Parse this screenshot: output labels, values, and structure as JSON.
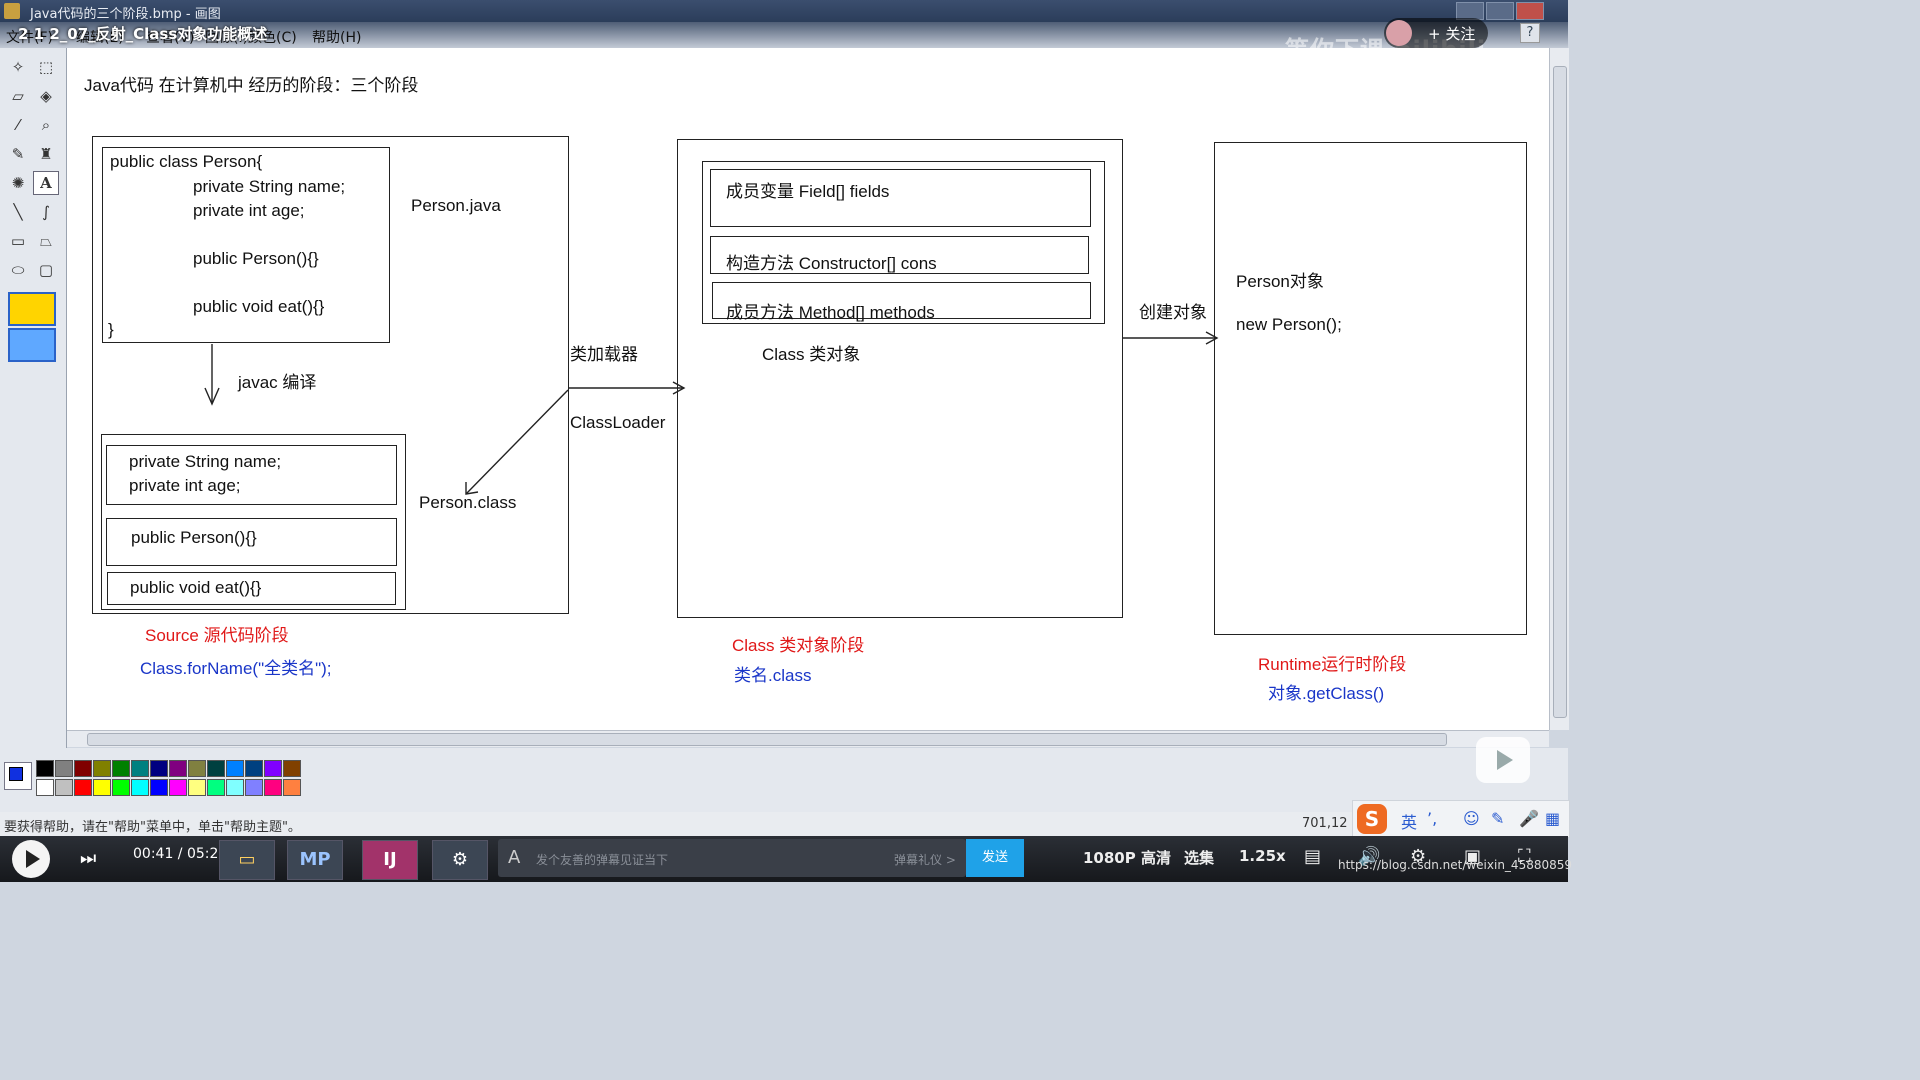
{
  "window": {
    "title": "Java代码的三个阶段.bmp - 画图",
    "menu": [
      "文件(F)",
      "编辑(E)",
      "查看(V)",
      "图像(I)",
      "颜色(C)",
      "帮助(H)"
    ]
  },
  "video": {
    "title": "2 1 2_07_反射_Class对象功能概述",
    "follow_label": "+ 关注",
    "watermark": "等你下课 bilibili"
  },
  "diagram": {
    "heading": "Java代码 在计算机中 经历的阶段：三个阶段",
    "source_code": {
      "line1": "public class Person{",
      "line2": "private String name;",
      "line3": "private int age;",
      "line4": "public Person(){}",
      "line5": "public void eat(){}",
      "line6": "}"
    },
    "person_java": "Person.java",
    "javac_label": "javac 编译",
    "class_fields": "private String name;\nprivate int age;",
    "class_fields_1": "private String name;",
    "class_fields_2": "private int age;",
    "class_ctor": "public Person(){}",
    "class_method": "public void eat(){}",
    "person_class": "Person.class",
    "loader_cn": "类加载器",
    "loader_en": "ClassLoader",
    "member_field": "成员变量  Field[] fields",
    "member_ctor": "构造方法  Constructor[] cons",
    "member_method": "成员方法 Method[] methods",
    "class_object": "Class 类对象",
    "create_object": "创建对象",
    "person_obj": "Person对象",
    "new_person": "new Person();",
    "stage1_title": "Source 源代码阶段",
    "stage1_code": "Class.forName(\"全类名\");",
    "stage2_title": "Class 类对象阶段",
    "stage2_code": "类名.class",
    "stage3_title": "Runtime运行时阶段",
    "stage3_code": "对象.getClass()"
  },
  "statusbar": {
    "hint": "要获得帮助，请在\"帮助\"菜单中，单击\"帮助主题\"。",
    "coord": "701,12"
  },
  "ime": {
    "lang": "英"
  },
  "player": {
    "time": "00:41 / 05:24",
    "danmaku_placeholder": "发个友善的弹幕见证当下",
    "etiquette": "弹幕礼仪 >",
    "send": "发送",
    "quality": "1080P 高清",
    "episodes": "选集",
    "speed": "1.25x",
    "url": "https://blog.csdn.net/weixin_45880859"
  },
  "taskbar": [
    "MP",
    "IJ"
  ],
  "colors": {
    "stage_title": "#e01818",
    "stage_code": "#1a36c8",
    "send_button": "#1fa2e8"
  }
}
